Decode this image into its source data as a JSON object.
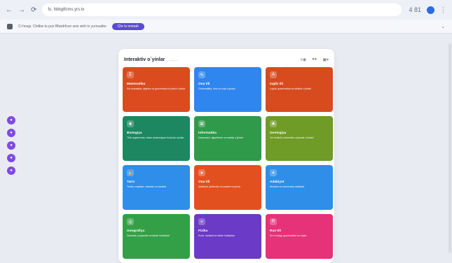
{
  "browser": {
    "address": "fu. hbbgtfcms.yrs.tv",
    "zoom": "4 81"
  },
  "notice": {
    "text": "Ci hnsgi. Chdkw tu pun Bfwidrfcun seis sinh tv yurnuatke",
    "button": "Chr tv nnmah"
  },
  "panel": {
    "title": "Interaktiv o`yinlar",
    "subtitle": "———",
    "controls": [
      "≡◉",
      "●●",
      "▣▾"
    ]
  },
  "cards": [
    {
      "title": "Matematika",
      "desc": "Sol mosalalar, algebra va geometriya bo'yicha o'yinlar",
      "color": "#db4b1f"
    },
    {
      "title": "Ona tili",
      "desc": "Grammatika, imlo va nutq o'yinlari",
      "color": "#2f86ee"
    },
    {
      "title": "Ingliz tili",
      "desc": "Lug'at, grammatika va talaffuz o'yinlari",
      "color": "#d84b1e"
    },
    {
      "title": "Biologiya",
      "desc": "Tirik organizmlar, odam anatomiyasi bo'yicha o'yinlar",
      "color": "#1d8761"
    },
    {
      "title": "Informatika",
      "desc": "Dasturlash, algoritmlar va mantiq o'yinlari",
      "color": "#2f9a4a"
    },
    {
      "title": "Geologiya",
      "desc": "Yer tuzilishi, minerallar va jinslar o'yinlari",
      "color": "#6f9b27"
    },
    {
      "title": "Tarix",
      "desc": "Tarixiy voqealar, shaxslar va sanalar",
      "color": "#2e8eea"
    },
    {
      "title": "Ona tili",
      "desc": "Adabiyot, ijodkorlar va asarlar bo'yicha",
      "color": "#e2501f"
    },
    {
      "title": "Adabiyot",
      "desc": "Mumtoz va zamonaviy adabiyot",
      "color": "#2f8fe8"
    },
    {
      "title": "Geografiya",
      "desc": "Davlatlar, poytaxtlar va tabiat hodisalari",
      "color": "#33a048"
    },
    {
      "title": "Fizika",
      "desc": "Kuch, harakat va elektr hodisalari",
      "color": "#6b3ac6"
    },
    {
      "title": "Rus tili",
      "desc": "So'z boyligi, grammatika va o'qish",
      "color": "#e53278"
    }
  ],
  "icons": [
    "menu-dot-1",
    "menu-dot-2",
    "menu-dot-3",
    "menu-dot-4",
    "menu-dot-5"
  ]
}
